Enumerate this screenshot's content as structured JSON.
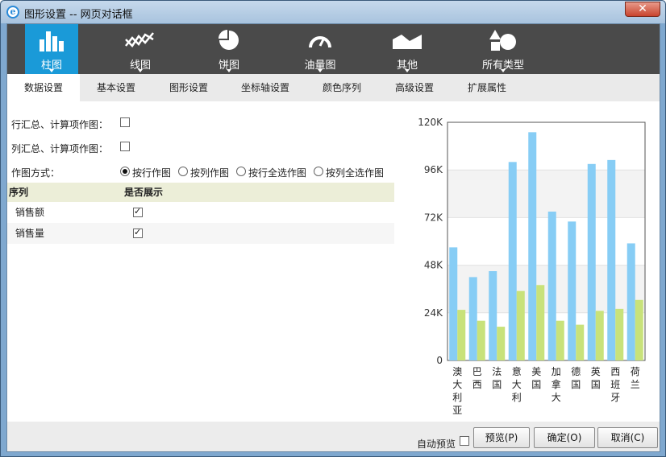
{
  "window": {
    "title": "图形设置 -- 网页对话框",
    "close_glyph": "✕"
  },
  "chart_types": [
    {
      "label": "柱图",
      "icon": "bar-chart-icon",
      "active": true
    },
    {
      "label": "线图",
      "icon": "line-chart-icon",
      "active": false
    },
    {
      "label": "饼图",
      "icon": "pie-chart-icon",
      "active": false
    },
    {
      "label": "油量图",
      "icon": "gauge-icon",
      "active": false
    },
    {
      "label": "其他",
      "icon": "area-chart-icon",
      "active": false
    },
    {
      "label": "所有类型",
      "icon": "shapes-icon",
      "active": false
    }
  ],
  "tabs": [
    {
      "label": "数据设置",
      "active": true
    },
    {
      "label": "基本设置",
      "active": false
    },
    {
      "label": "图形设置",
      "active": false
    },
    {
      "label": "坐标轴设置",
      "active": false
    },
    {
      "label": "颜色序列",
      "active": false
    },
    {
      "label": "高级设置",
      "active": false
    },
    {
      "label": "扩展属性",
      "active": false
    }
  ],
  "form": {
    "row_total_label": "行汇总、计算项作图：",
    "row_total_checked": false,
    "col_total_label": "列汇总、计算项作图：",
    "col_total_checked": false,
    "plot_mode_label": "作图方式：",
    "plot_mode_options": [
      "按行作图",
      "按列作图",
      "按行全选作图",
      "按列全选作图"
    ],
    "plot_mode_selected": "按行作图"
  },
  "series_table": {
    "headers": [
      "序列",
      "是否展示"
    ],
    "rows": [
      {
        "name": "销售额",
        "shown": true
      },
      {
        "name": "销售量",
        "shown": true
      }
    ]
  },
  "chart_data": {
    "type": "bar",
    "categories": [
      "澳大利亚",
      "巴西",
      "法国",
      "意大利",
      "美国",
      "加拿大",
      "德国",
      "英国",
      "西班牙",
      "荷兰"
    ],
    "series": [
      {
        "values": [
          57000,
          42000,
          45000,
          100000,
          115000,
          75000,
          70000,
          99000,
          101000,
          59000
        ],
        "color": "#87cdf5"
      },
      {
        "values": [
          25500,
          20000,
          17000,
          35000,
          38000,
          20000,
          18000,
          25000,
          26000,
          30500
        ],
        "color": "#c8e27a"
      }
    ],
    "ylim": [
      0,
      120000
    ],
    "yticks": [
      0,
      24000,
      48000,
      72000,
      96000,
      120000
    ],
    "ytick_labels": [
      "0",
      "24K",
      "48K",
      "72K",
      "96K",
      "120K"
    ],
    "grid": true,
    "title": "",
    "xlabel": "",
    "ylabel": ""
  },
  "bottom": {
    "auto_preview_label": "自动预览",
    "auto_preview_checked": false,
    "preview_button": "预览(P)",
    "ok_button": "确定(O)",
    "cancel_button": "取消(C)"
  },
  "colors": {
    "accent": "#1a9ad8",
    "toolbar_bg": "#4a4a4a",
    "table_header_bg": "#eceed8"
  }
}
